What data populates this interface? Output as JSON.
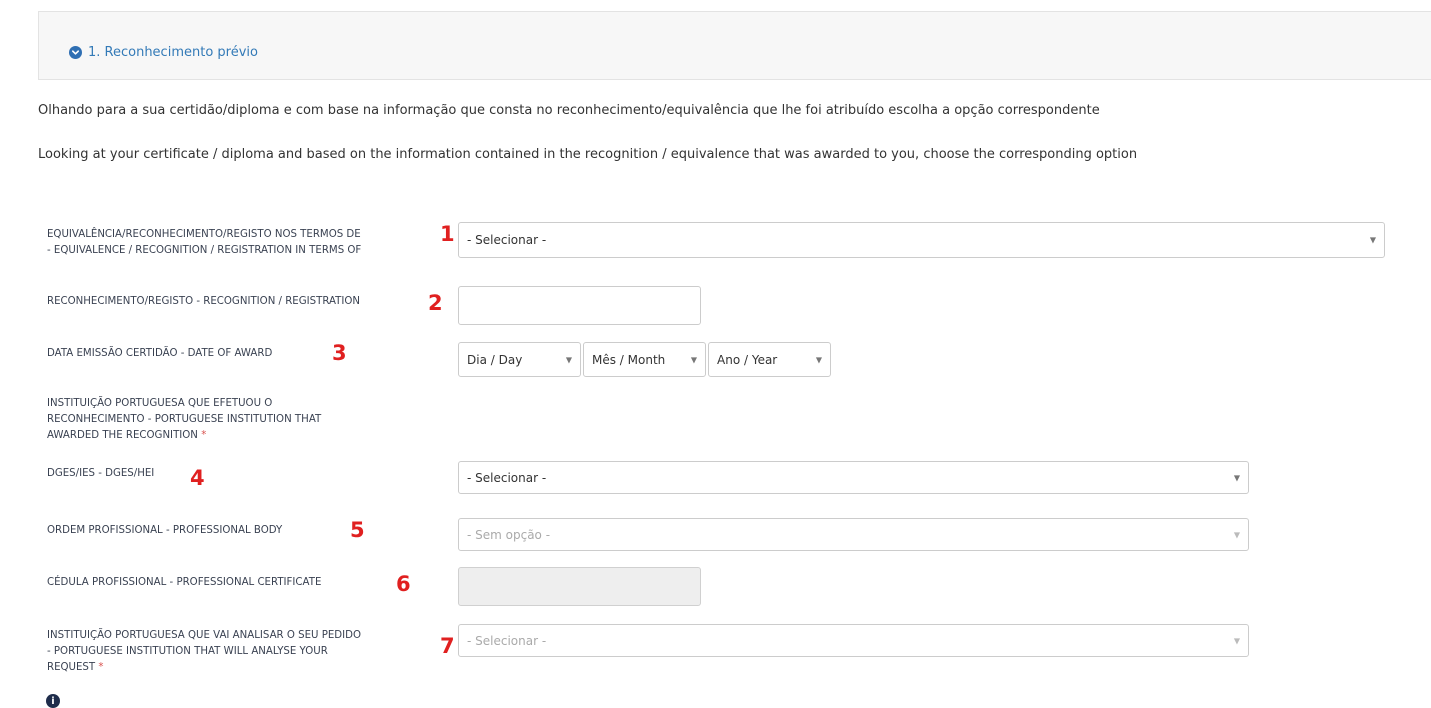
{
  "section": {
    "title": "1. Reconhecimento prévio"
  },
  "intro": {
    "pt": "Olhando para a sua certidão/diploma e com base na informação que consta no reconhecimento/equivalência que lhe foi atribuído escolha a opção correspondente",
    "en": "Looking at your certificate / diploma and based on the information contained in the recognition / equivalence that was awarded to you, choose the corresponding option"
  },
  "fields": {
    "equivalence": {
      "label_line1": "EQUIVALÊNCIA/RECONHECIMENTO/REGISTO NOS TERMOS DE",
      "label_line2": "- EQUIVALENCE / RECOGNITION / REGISTRATION IN TERMS OF",
      "number": "1",
      "value": "- Selecionar -"
    },
    "recognition": {
      "label": "RECONHECIMENTO/REGISTO - RECOGNITION / REGISTRATION",
      "number": "2",
      "value": ""
    },
    "date_of_award": {
      "label": "DATA EMISSÃO CERTIDÃO - DATE OF AWARD",
      "number": "3",
      "day": "Dia / Day",
      "month": "Mês / Month",
      "year": "Ano / Year"
    },
    "institution_group": {
      "line1": "INSTITUIÇÃO PORTUGUESA QUE EFETUOU O",
      "line2": "RECONHECIMENTO - PORTUGUESE INSTITUTION THAT",
      "line3": "AWARDED THE RECOGNITION",
      "required": "*"
    },
    "dges": {
      "label": "DGES/IES - DGES/HEI",
      "number": "4",
      "value": "- Selecionar -"
    },
    "professional_body": {
      "label": "ORDEM PROFISSIONAL - PROFESSIONAL BODY",
      "number": "5",
      "value": "- Sem opção -"
    },
    "professional_certificate": {
      "label": "CÉDULA PROFISSIONAL - PROFESSIONAL CERTIFICATE",
      "number": "6",
      "value": ""
    },
    "analysing_institution": {
      "line1": "INSTITUIÇÃO PORTUGUESA QUE VAI ANALISAR O SEU PEDIDO",
      "line2": "- PORTUGUESE INSTITUTION THAT WILL ANALYSE YOUR",
      "line3": "REQUEST",
      "required": "*",
      "number": "7",
      "value": "- Selecionar -"
    }
  },
  "icons": {
    "chevron": "chevron-down-circle-icon",
    "info": "info-circle-icon",
    "dropdown_arrow": "caret-down-icon"
  },
  "colors": {
    "accent": "#337ab7",
    "annotation_red": "#e02020",
    "required_red": "#d9534f",
    "panel_bg": "#f7f7f7"
  }
}
